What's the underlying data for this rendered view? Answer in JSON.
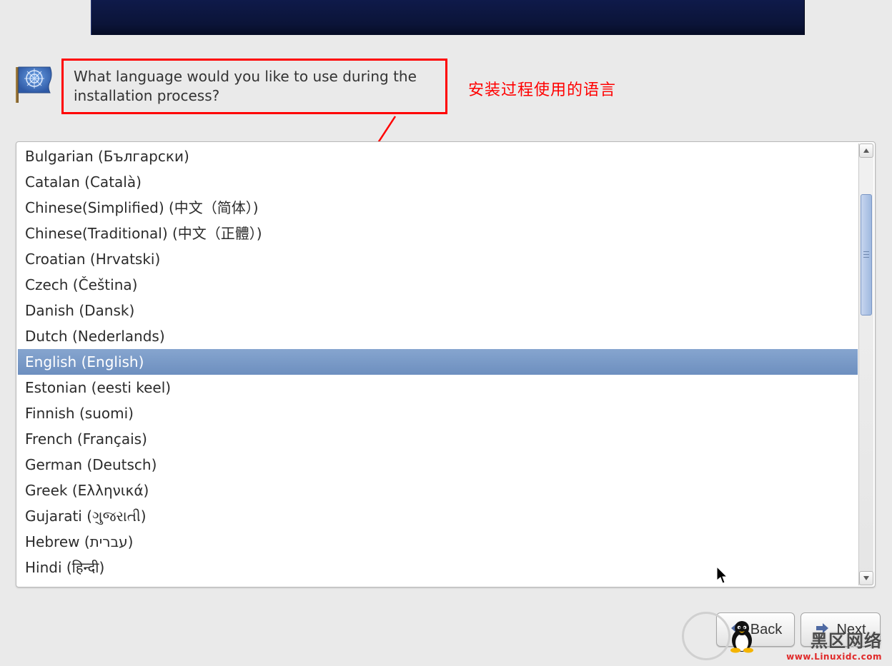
{
  "prompt": "What language would you like to use during the installation process?",
  "annotation": "安装过程使用的语言",
  "languages": [
    {
      "label": "Bulgarian (Български)",
      "selected": false
    },
    {
      "label": "Catalan (Català)",
      "selected": false
    },
    {
      "label": "Chinese(Simplified) (中文（简体）)",
      "selected": false
    },
    {
      "label": "Chinese(Traditional) (中文（正體）)",
      "selected": false
    },
    {
      "label": "Croatian (Hrvatski)",
      "selected": false
    },
    {
      "label": "Czech (Čeština)",
      "selected": false
    },
    {
      "label": "Danish (Dansk)",
      "selected": false
    },
    {
      "label": "Dutch (Nederlands)",
      "selected": false
    },
    {
      "label": "English (English)",
      "selected": true
    },
    {
      "label": "Estonian (eesti keel)",
      "selected": false
    },
    {
      "label": "Finnish (suomi)",
      "selected": false
    },
    {
      "label": "French (Français)",
      "selected": false
    },
    {
      "label": "German (Deutsch)",
      "selected": false
    },
    {
      "label": "Greek (Ελληνικά)",
      "selected": false
    },
    {
      "label": "Gujarati (ગુજરાતી)",
      "selected": false
    },
    {
      "label": "Hebrew (עברית)",
      "selected": false
    },
    {
      "label": "Hindi (हिन्दी)",
      "selected": false
    }
  ],
  "buttons": {
    "back": "Back",
    "next": "Next"
  },
  "watermark": {
    "line1": "黑区网络",
    "line2": "www.Linuxidc.com"
  }
}
